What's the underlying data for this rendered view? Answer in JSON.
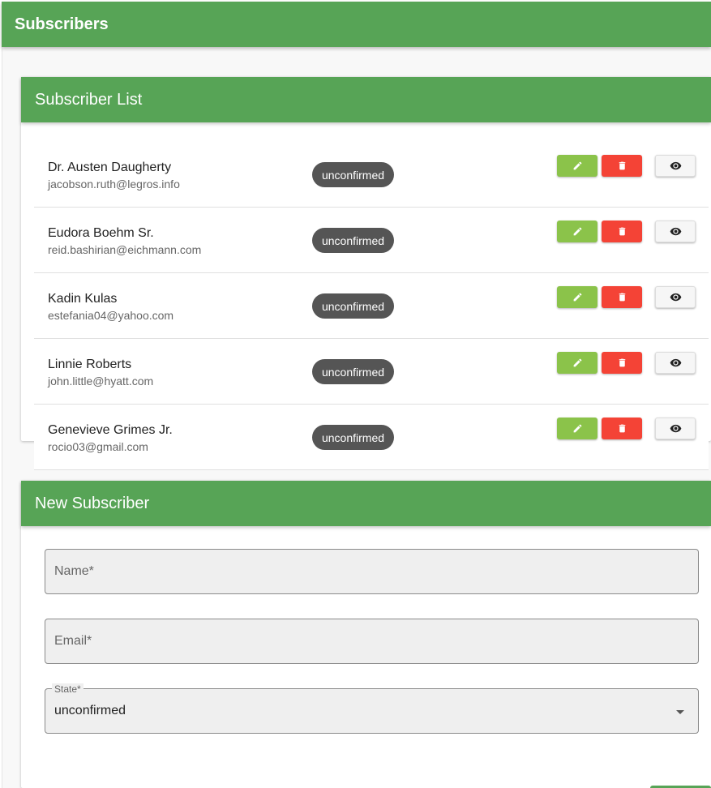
{
  "app": {
    "title": "Subscribers"
  },
  "subscriber_list": {
    "title": "Subscriber List",
    "rows": [
      {
        "name": "Dr. Austen Daugherty",
        "email": "jacobson.ruth@legros.info",
        "state": "unconfirmed"
      },
      {
        "name": "Eudora Boehm Sr.",
        "email": "reid.bashirian@eichmann.com",
        "state": "unconfirmed"
      },
      {
        "name": "Kadin Kulas",
        "email": "estefania04@yahoo.com",
        "state": "unconfirmed"
      },
      {
        "name": "Linnie Roberts",
        "email": "john.little@hyatt.com",
        "state": "unconfirmed"
      },
      {
        "name": "Genevieve Grimes Jr.",
        "email": "rocio03@gmail.com",
        "state": "unconfirmed"
      }
    ],
    "actions": {
      "edit_icon": "pencil-icon",
      "delete_icon": "trash-icon",
      "view_icon": "eye-icon"
    }
  },
  "new_subscriber": {
    "title": "New Subscriber",
    "name_label": "Name*",
    "email_label": "Email*",
    "state_label": "State*",
    "state_value": "unconfirmed"
  },
  "colors": {
    "primary": "#57a456",
    "edit": "#8bc34a",
    "delete": "#f44336",
    "chip": "#555555"
  }
}
